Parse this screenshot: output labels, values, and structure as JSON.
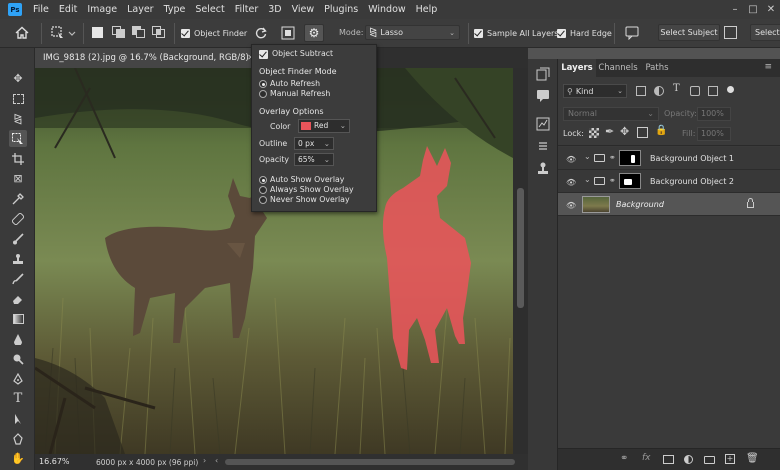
{
  "menubar": {
    "logo": "Ps",
    "items": [
      "File",
      "Edit",
      "Image",
      "Layer",
      "Type",
      "Select",
      "Filter",
      "3D",
      "View",
      "Plugins",
      "Window",
      "Help"
    ]
  },
  "options": {
    "object_finder_label": "Object Finder",
    "mode_label": "Mode:",
    "mode_value": "Lasso",
    "sample_all_layers_label": "Sample All Layers",
    "hard_edge_label": "Hard Edge",
    "select_subject_label": "Select Subject",
    "select_partial_label": "Select"
  },
  "document": {
    "tab_title": "IMG_9818 (2).jpg @ 16.7% (Background, RGB/8) *",
    "zoom": "16.67%",
    "info": "6000 px x 4000 px (96 ppi)"
  },
  "finder_menu": {
    "object_subtract_label": "Object Subtract",
    "mode_heading": "Object Finder Mode",
    "auto_refresh_label": "Auto Refresh",
    "manual_refresh_label": "Manual Refresh",
    "overlay_heading": "Overlay Options",
    "color_label": "Color",
    "color_value": "Red",
    "outline_label": "Outline",
    "outline_value": "0 px",
    "opacity_label": "Opacity",
    "opacity_value": "65%",
    "auto_show_label": "Auto Show Overlay",
    "always_show_label": "Always Show Overlay",
    "never_show_label": "Never Show Overlay",
    "overlay_color": "#e8545a"
  },
  "layers_panel": {
    "tabs": [
      "Layers",
      "Channels",
      "Paths"
    ],
    "kind_label": "Kind",
    "blend_mode": "Normal",
    "opacity_label": "Opacity:",
    "opacity_value": "100%",
    "lock_label": "Lock:",
    "fill_label": "Fill:",
    "fill_value": "100%",
    "layers": [
      {
        "name": "Background Object 1"
      },
      {
        "name": "Background Object 2"
      },
      {
        "name": "Background"
      }
    ]
  },
  "colors": {
    "accent": "#2fa3f7",
    "overlay": "#e8545a"
  }
}
